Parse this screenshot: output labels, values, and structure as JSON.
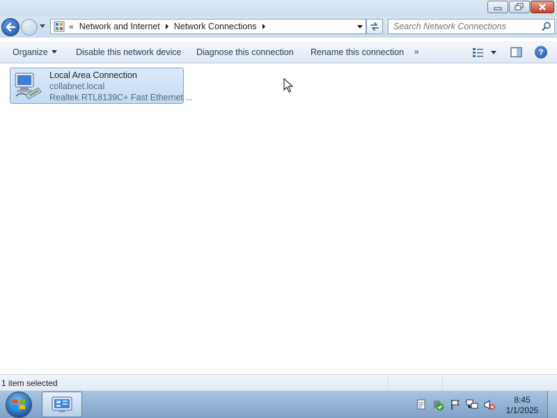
{
  "window": {
    "minimize_icon": "minimize-icon",
    "restore_icon": "restore-icon",
    "close_icon": "close-icon"
  },
  "navigation": {
    "back_icon": "back-arrow-icon",
    "forward_icon": "forward-arrow-icon",
    "address": {
      "overflow_chevron": "«",
      "breadcrumbs": [
        "Network and Internet",
        "Network Connections"
      ]
    },
    "search_placeholder": "Search Network Connections"
  },
  "commandbar": {
    "organize": "Organize",
    "disable": "Disable this network device",
    "diagnose": "Diagnose this connection",
    "rename": "Rename this connection",
    "more": "»",
    "help": "?"
  },
  "connection": {
    "name": "Local Area Connection",
    "domain": "collabnet.local",
    "adapter": "Realtek RTL8139C+ Fast Ethernet ..."
  },
  "statusbar": {
    "text": "1 item selected"
  },
  "taskbar": {
    "time": "8:45",
    "date": "1/1/2025"
  },
  "colors": {
    "selection_fill": "#c8e0f6",
    "selection_border": "#7da2ce",
    "taskbar": "#94b4d6",
    "accent": "#1e395b"
  }
}
